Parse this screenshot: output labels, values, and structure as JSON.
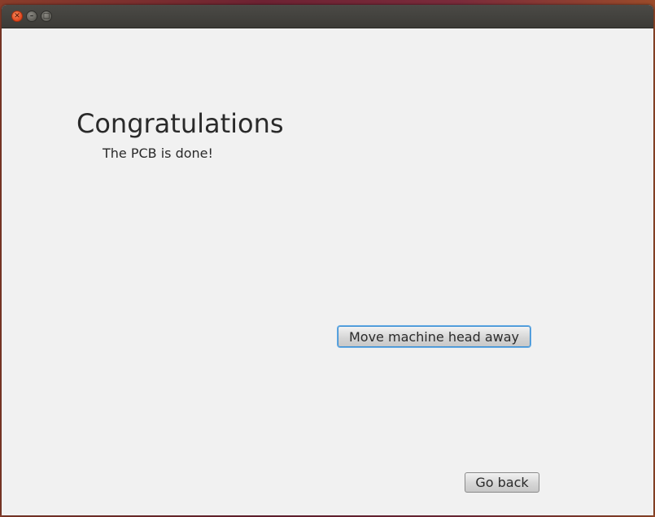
{
  "window": {
    "controls": {
      "close_icon": "close-icon",
      "minimize_icon": "minimize-icon",
      "maximize_icon": "maximize-icon"
    }
  },
  "main": {
    "heading": "Congratulations",
    "message": "The PCB is done!",
    "move_button_label": "Move machine head away",
    "back_button_label": "Go back"
  },
  "colors": {
    "focus_ring": "#3c8fd3",
    "close_button": "#e0451d",
    "window_background": "#f1f1f1",
    "titlebar": "#3c3b37"
  }
}
